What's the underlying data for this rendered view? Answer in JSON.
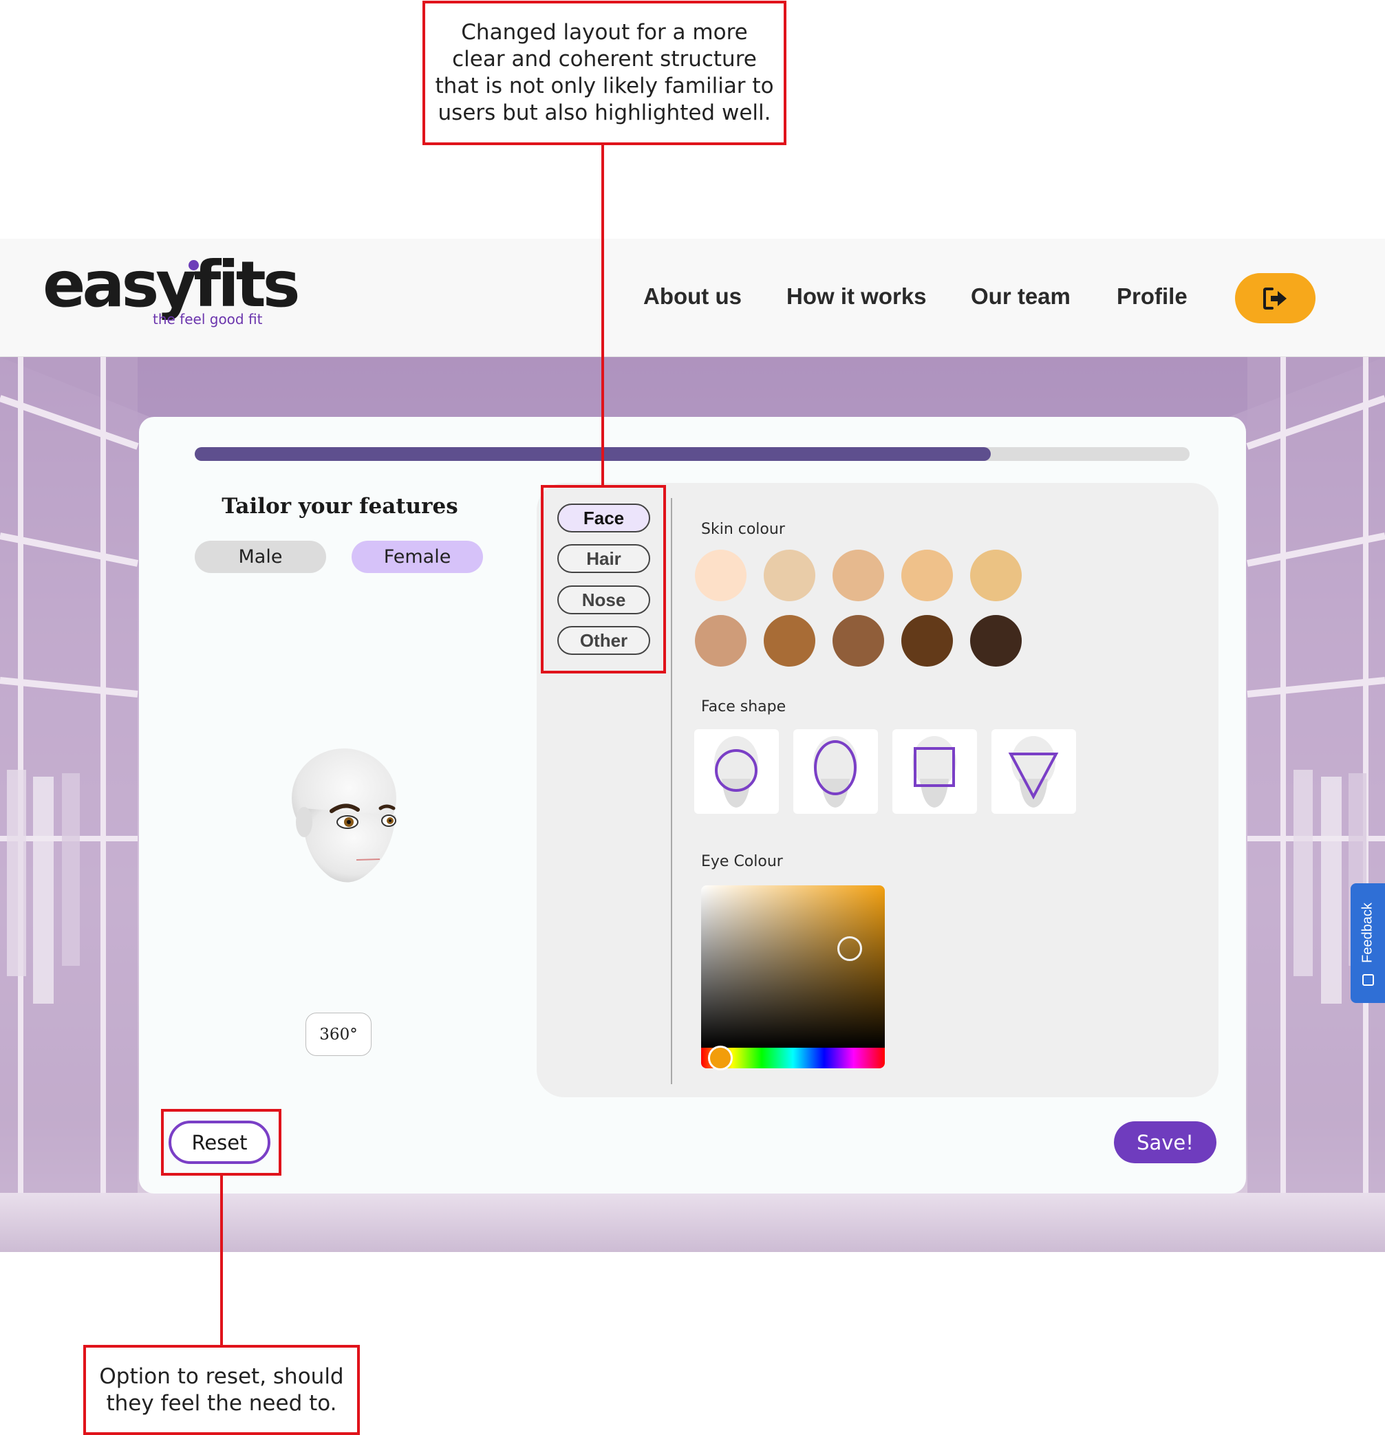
{
  "annotations": {
    "top_note": "Changed layout for a more clear and coherent structure that is not only likely familiar to users but also highlighted well.",
    "bottom_note": "Option to reset, should they feel the need to."
  },
  "header": {
    "logo": {
      "wordmark": "easyfits",
      "tagline": "the feel good fit"
    },
    "nav": [
      "About us",
      "How it works",
      "Our team",
      "Profile"
    ],
    "logout_icon": "logout-icon",
    "accent_color": "#f7a81b"
  },
  "editor": {
    "progress": 0.8,
    "title": "Tailor your features",
    "gender": {
      "male": "Male",
      "female": "Female",
      "selected": "Female"
    },
    "rotate_label": "360°",
    "tabs": [
      "Face",
      "Hair",
      "Nose",
      "Other"
    ],
    "active_tab": "Face",
    "skin_label": "Skin colour",
    "skin_colors": [
      "#fde0c8",
      "#e9cca8",
      "#e6b98e",
      "#efc18a",
      "#ebc283",
      "#cf9c79",
      "#a86c36",
      "#905e3a",
      "#633a19",
      "#40291c"
    ],
    "face_label": "Face shape",
    "face_shapes": [
      "round",
      "oval",
      "square",
      "triangle"
    ],
    "eye_label": "Eye Colour",
    "eye_hue_color": "#f3a112",
    "reset_label": "Reset",
    "save_label": "Save!"
  },
  "feedback": {
    "label": "Feedback",
    "color": "#2f6fd6"
  },
  "colors": {
    "brand_purple": "#6f3cbe",
    "progress": "#5e4f8e",
    "annotation_red": "#e0131b"
  }
}
